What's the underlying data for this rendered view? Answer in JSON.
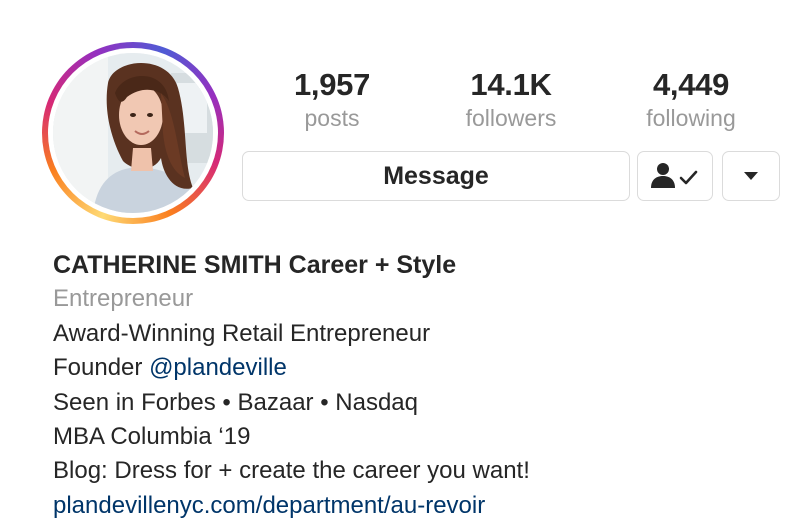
{
  "profile": {
    "stats": [
      {
        "value": "1,957",
        "label": "posts"
      },
      {
        "value": "14.1K",
        "label": "followers"
      },
      {
        "value": "4,449",
        "label": "following"
      }
    ],
    "buttons": {
      "message_label": "Message"
    },
    "bio": {
      "name": "CATHERINE SMITH Career + Style",
      "category": "Entrepreneur",
      "line1": "Award-Winning Retail Entrepreneur",
      "line2_prefix": "Founder ",
      "line2_mention": "@plandeville",
      "line3": "Seen in Forbes • Bazaar • Nasdaq",
      "line4": "MBA Columbia ‘19",
      "line5": "Blog: Dress for + create the career you want!",
      "website": "plandevillenyc.com/department/au-revoir"
    }
  },
  "icons": {
    "follow_status": "person-check-icon",
    "more": "caret-down-icon"
  },
  "colors": {
    "link": "#003569",
    "muted": "#999999",
    "text": "#262626",
    "border": "#dbdbdb"
  }
}
